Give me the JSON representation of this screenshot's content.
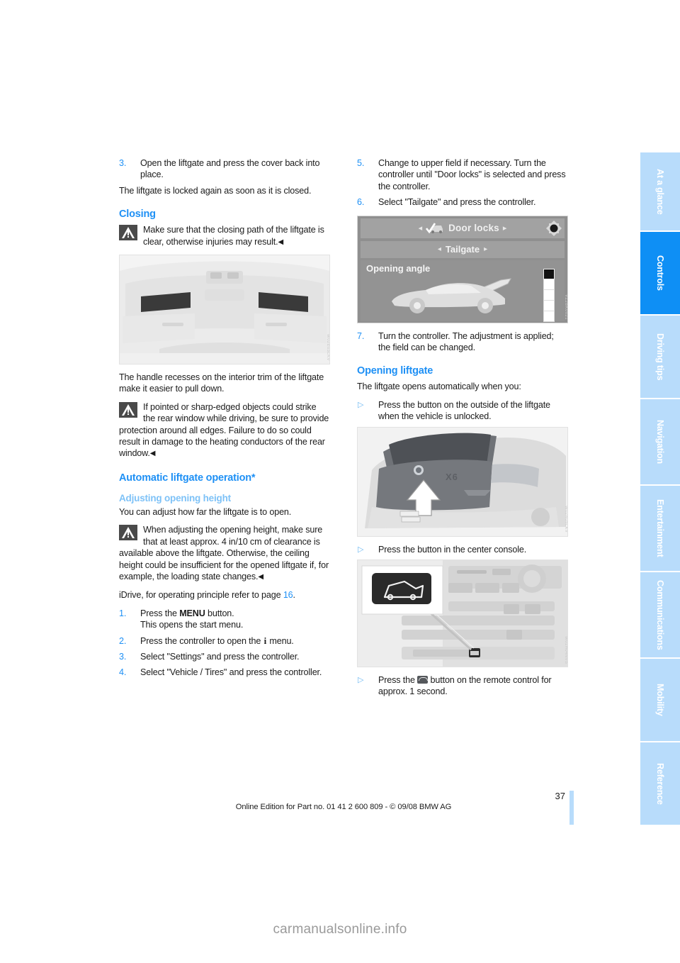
{
  "document": {
    "page_number": "37",
    "imprint": "Online Edition for Part no. 01 41 2 600 809 - © 09/08 BMW AG",
    "watermark": "carmanualsonline.info"
  },
  "sidebar": {
    "tabs": [
      {
        "label": "At a glance",
        "active": false
      },
      {
        "label": "Controls",
        "active": true
      },
      {
        "label": "Driving tips",
        "active": false
      },
      {
        "label": "Navigation",
        "active": false
      },
      {
        "label": "Entertainment",
        "active": false
      },
      {
        "label": "Communications",
        "active": false
      },
      {
        "label": "Mobility",
        "active": false
      },
      {
        "label": "Reference",
        "active": false
      }
    ]
  },
  "left_column": {
    "step3_num": "3.",
    "step3_text": "Open the liftgate and press the cover back into place.",
    "para_locked": "The liftgate is locked again as soon as it is closed.",
    "heading_closing": "Closing",
    "warn_closing": "Make sure that the closing path of the liftgate is clear, otherwise injuries may result.",
    "fig_interior_trim_code": "W02E03LKV",
    "para_handle": "The handle recesses on the interior trim of the liftgate make it easier to pull down.",
    "warn_window": "If pointed or sharp-edged objects could strike the rear window while driving, be sure to provide protection around all edges. Failure to do so could result in damage to the heating conductors of the rear window.",
    "heading_auto": "Automatic liftgate operation*",
    "heading_adjust": "Adjusting opening height",
    "para_adjust": "You can adjust how far the liftgate is to open.",
    "warn_adjust": "When adjusting the opening height, make sure that at least approx. 4 in/10 cm of clearance is available above the liftgate. Otherwise, the ceiling height could be insufficient for the opened liftgate if, for example, the loading state changes.",
    "idrive_ref_pre": "iDrive, for operating principle refer to page ",
    "idrive_ref_link": "16",
    "idrive_ref_post": ".",
    "step1_num": "1.",
    "step1_text_pre": "Press the ",
    "step1_text_bold": "MENU",
    "step1_text_post": " button.",
    "step1_subline": "This opens the start menu.",
    "step2_num": "2.",
    "step2_text_pre": "Press the controller to open the ",
    "step2_glyph": "i",
    "step2_text_post": " menu.",
    "step4_num": "3.",
    "step4_text": "Select \"Settings\" and press the controller.",
    "step5_num": "4.",
    "step5_text": "Select \"Vehicle / Tires\" and press the controller."
  },
  "right_column": {
    "step5_num": "5.",
    "step5_text": "Change to upper field if necessary. Turn the controller until \"Door locks\" is selected and press the controller.",
    "step6_num": "6.",
    "step6_text": "Select \"Tailgate\" and press the controller.",
    "idrive_screen": {
      "top_menu_label": "Door locks",
      "sub_menu_label": "Tailgate",
      "field_label": "Opening angle",
      "left_arrow": "◂",
      "right_arrow": "▸",
      "code": "VZ2BK0021"
    },
    "step7_num": "7.",
    "step7_text": "Turn the controller. The adjustment is applied; the field can be changed.",
    "heading_opening": "Opening liftgate",
    "para_opens_auto": "The liftgate opens automatically when you:",
    "bullet1": "Press the button on the outside of the liftgate when the vehicle is unlocked.",
    "fig_rear_code": "W02R05LKV",
    "bullet2": "Press the button in the center console.",
    "fig_console_code": "W01H04NVS",
    "bullet3_pre": "Press the ",
    "bullet3_post": " button on the remote control for approx. 1 second."
  },
  "colors": {
    "heading_primary": "#1e90f5",
    "heading_secondary": "#7ec2f7",
    "tab_active": "#0e8ff5",
    "tab_inactive": "#b8dcfb",
    "body_text": "#1b1b1b"
  }
}
